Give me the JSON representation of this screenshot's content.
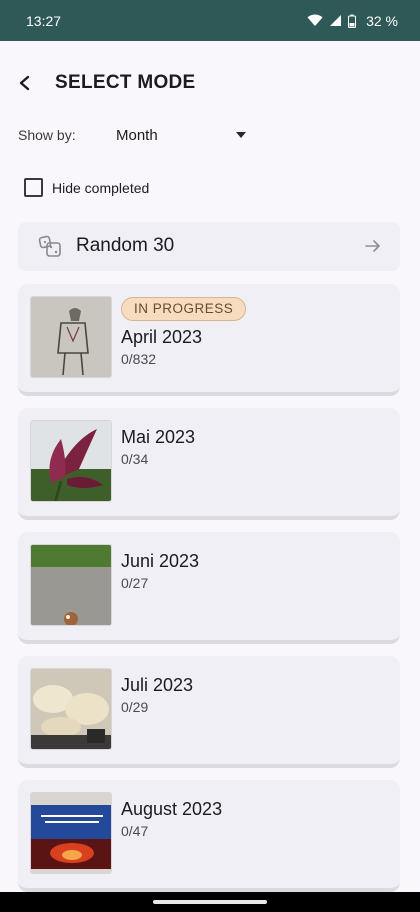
{
  "status_bar": {
    "time": "13:27",
    "battery": "32 %"
  },
  "header": {
    "title": "SELECT MODE"
  },
  "show_by": {
    "label": "Show by:",
    "value": "Month"
  },
  "hide_completed": {
    "label": "Hide completed",
    "checked": false
  },
  "random": {
    "label": "Random 30"
  },
  "months": [
    {
      "title": "April 2023",
      "count": "0/832",
      "badge": "IN PROGRESS"
    },
    {
      "title": "Mai 2023",
      "count": "0/34"
    },
    {
      "title": "Juni 2023",
      "count": "0/27"
    },
    {
      "title": "Juli 2023",
      "count": "0/29"
    },
    {
      "title": "August 2023",
      "count": "0/47"
    }
  ],
  "colors": {
    "status_bar": "#2f5956",
    "card": "#f1eff6",
    "badge": "#f7dcc0",
    "background": "#f9f7fb"
  }
}
